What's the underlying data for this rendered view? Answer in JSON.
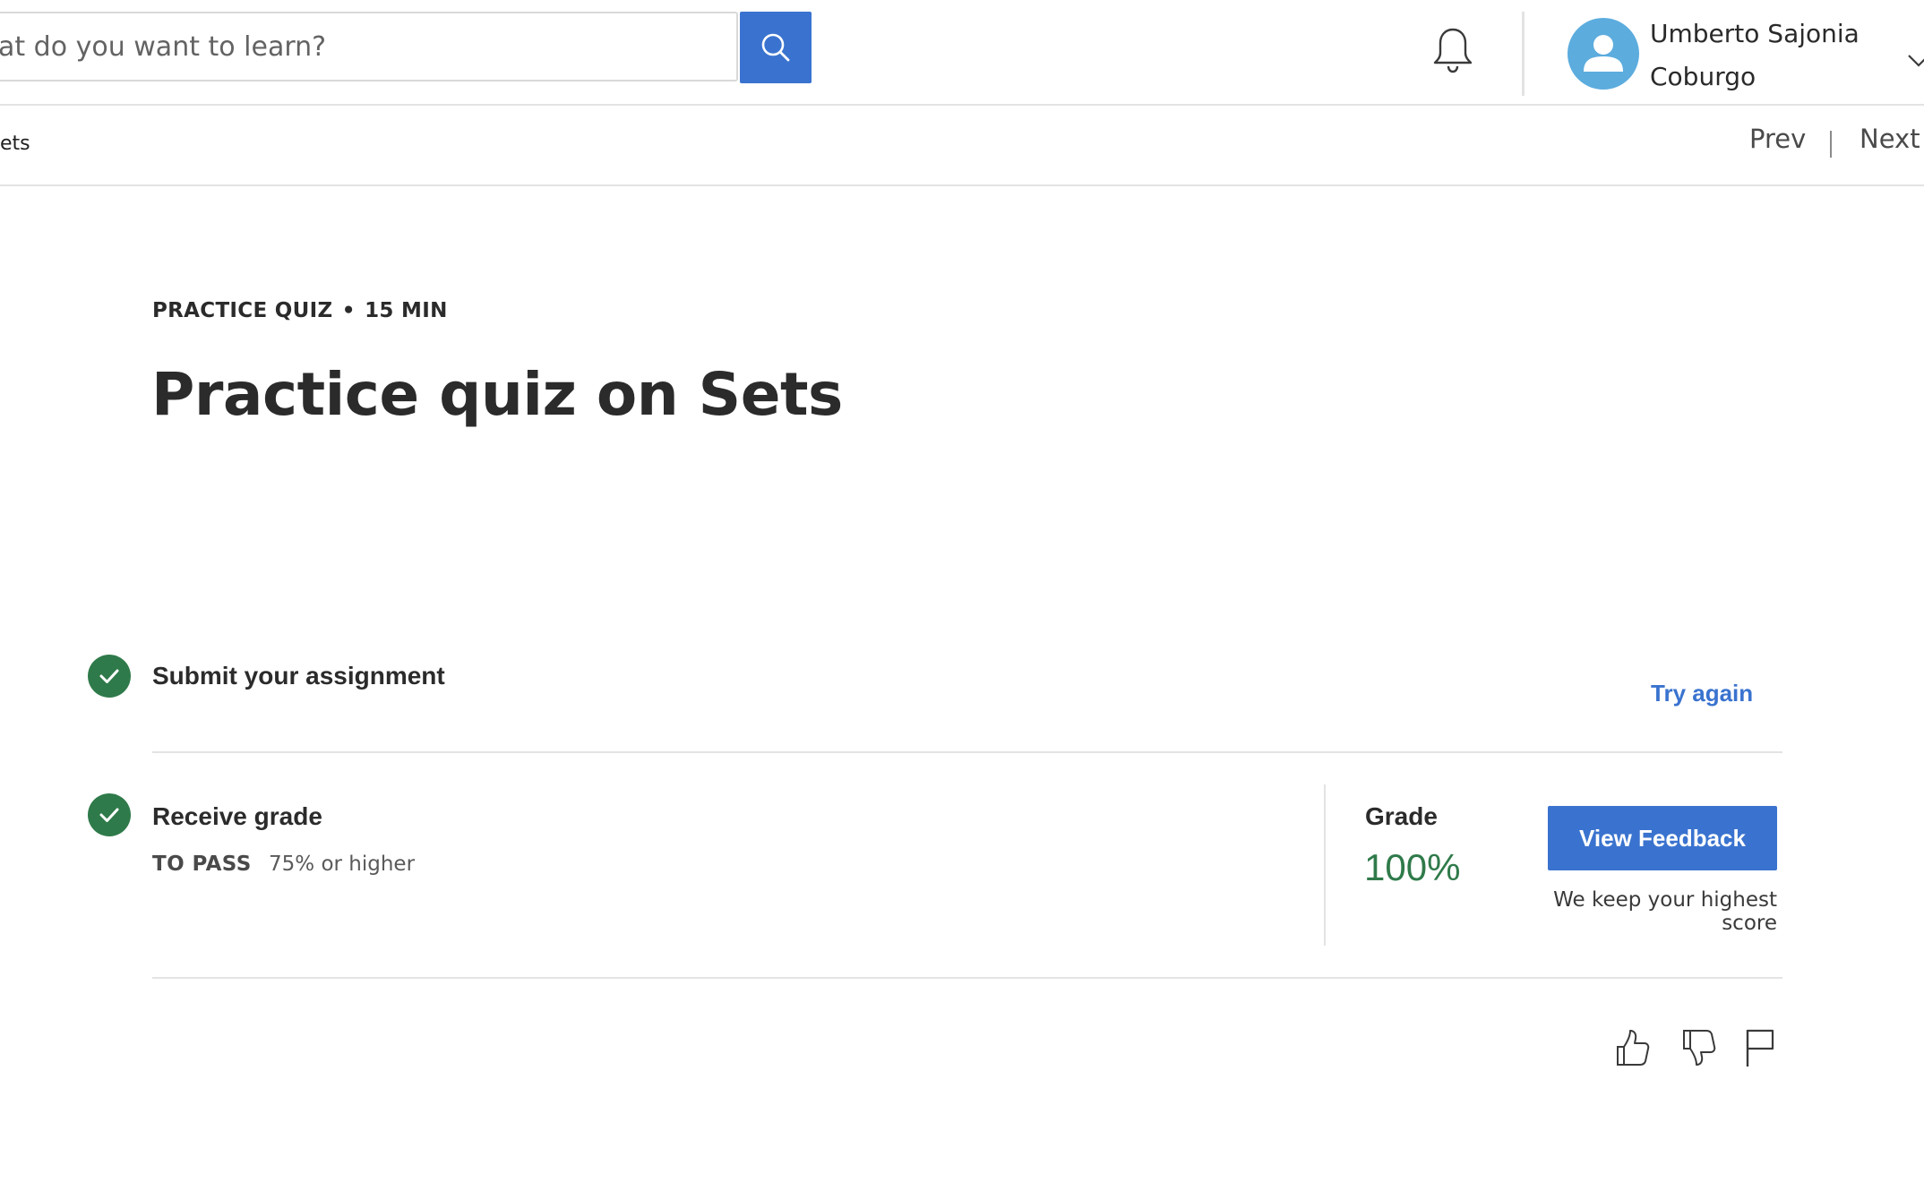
{
  "header": {
    "search": {
      "value": "",
      "placeholder": "at do you want to learn?"
    },
    "user": {
      "name_line1": "Umberto Sajonia",
      "name_line2": "Coburgo"
    }
  },
  "subheader": {
    "breadcrumb": "ets",
    "prev_label": "Prev",
    "next_label": "Next"
  },
  "quiz": {
    "type_label": "PRACTICE QUIZ",
    "separator": "•",
    "duration": "15 MIN",
    "title": "Practice quiz on Sets"
  },
  "steps": {
    "submit": {
      "title": "Submit your assignment",
      "action_label": "Try again"
    },
    "receive": {
      "title": "Receive grade",
      "to_pass_label": "TO PASS",
      "to_pass_value": "75% or higher",
      "grade_label": "Grade",
      "grade_value": "100%",
      "feedback_button": "View Feedback",
      "note": "We keep your highest score"
    }
  },
  "colors": {
    "primary": "#3a73cf",
    "success": "#2f7a4a",
    "avatar": "#5cacde"
  },
  "icons": [
    "search-icon",
    "bell-icon",
    "user-icon",
    "chevron-down-icon",
    "check-icon",
    "thumbs-up-icon",
    "thumbs-down-icon",
    "flag-icon"
  ]
}
